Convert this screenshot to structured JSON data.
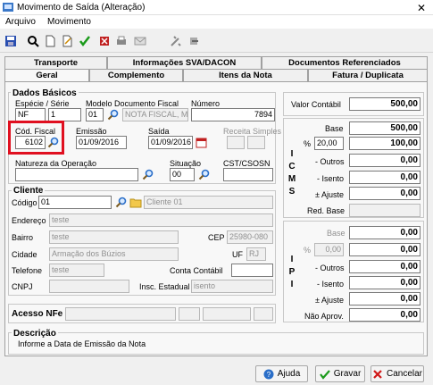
{
  "window": {
    "title": "Movimento de Saída (Alteração)"
  },
  "menu": {
    "arquivo": "Arquivo",
    "movimento": "Movimento"
  },
  "tabs_top": [
    "Transporte",
    "Informações SVA/DACON",
    "Documentos Referenciados"
  ],
  "tabs_bottom": [
    "Geral",
    "Complemento",
    "Itens da Nota",
    "Fatura / Duplicata"
  ],
  "dados_basicos": {
    "title": "Dados Básicos",
    "especie_serie_label": "Espécie  /  Série",
    "especie": "NF",
    "serie": "1",
    "modelo_label": "Modelo Documento Fiscal",
    "modelo_code": "01",
    "modelo_desc": "NOTA FISCAL, MO",
    "numero_label": "Número",
    "numero": "7894",
    "cod_fiscal_label": "Cód. Fiscal",
    "cod_fiscal": "6102",
    "emissao_label": "Emissão",
    "emissao": "01/09/2016",
    "saida_label": "Saída",
    "saida": "01/09/2016",
    "receita_label": "Receita Simples",
    "natureza_label": "Natureza da Operação",
    "natureza": "",
    "situacao_label": "Situação",
    "situacao": "00",
    "cst_label": "CST/CSOSN",
    "cst": ""
  },
  "cliente": {
    "title": "Cliente",
    "codigo_label": "Código",
    "codigo": "01",
    "nome": "Cliente 01",
    "endereco_label": "Endereço",
    "endereco": "teste",
    "bairro_label": "Bairro",
    "bairro": "teste",
    "cep_label": "CEP",
    "cep": "25980-080",
    "cidade_label": "Cidade",
    "cidade": "Armação dos Búzios",
    "uf_label": "UF",
    "uf": "RJ",
    "telefone_label": "Telefone",
    "telefone": "teste",
    "conta_label": "Conta Contábil",
    "conta": "",
    "cnpj_label": "CNPJ",
    "cnpj": "",
    "insc_label": "Insc. Estadual",
    "insc": "isento"
  },
  "acesso_nfe_label": "Acesso NFe",
  "descricao": {
    "title": "Descrição",
    "text": "Informe a Data de Emissão da Nota"
  },
  "valor_contabil": {
    "label": "Valor Contábil",
    "value": "500,00"
  },
  "icms": {
    "letters": [
      "I",
      "C",
      "M",
      "S"
    ],
    "base_label": "Base",
    "base": "500,00",
    "pct_label": "%",
    "pct": "20,00",
    "valor": "100,00",
    "outros_label": "- Outros",
    "outros": "0,00",
    "isento_label": "- Isento",
    "isento": "0,00",
    "ajuste_label": "± Ajuste",
    "ajuste": "0,00",
    "red_label": "Red. Base",
    "red": ""
  },
  "ipi": {
    "letters": [
      "I",
      "P",
      "I"
    ],
    "base_label": "Base",
    "base": "0,00",
    "pct_label": "%",
    "pct": "0,00",
    "valor": "0,00",
    "outros_label": "- Outros",
    "outros": "0,00",
    "isento_label": "- Isento",
    "isento": "0,00",
    "ajuste_label": "± Ajuste",
    "ajuste": "0,00",
    "naoaprov_label": "Não Aprov.",
    "naoaprov": "0,00"
  },
  "buttons": {
    "ajuda": "Ajuda",
    "gravar": "Gravar",
    "cancelar": "Cancelar"
  }
}
